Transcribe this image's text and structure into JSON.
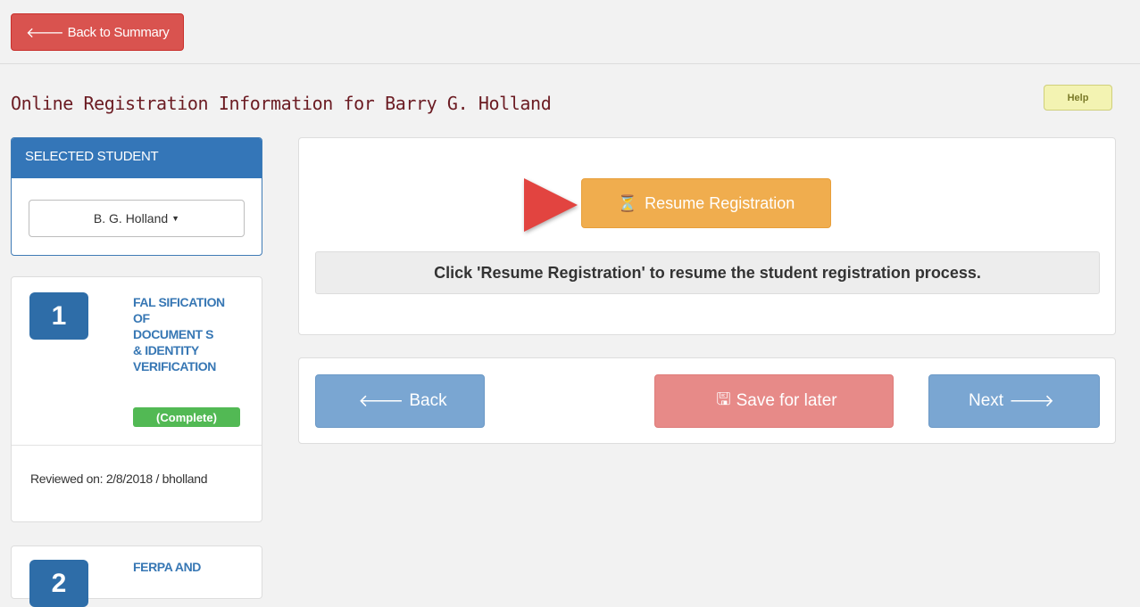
{
  "topbar": {
    "back_label": "Back to Summary"
  },
  "page": {
    "title": "Online Registration Information for Barry G. Holland",
    "help_label": "Help"
  },
  "student_panel": {
    "heading": "SELECTED STUDENT",
    "selected": "B. G. Holland"
  },
  "steps": [
    {
      "number": "1",
      "title_lines": [
        "FAL SIFICATION",
        "OF",
        "DOCUMENT S",
        "& IDENTITY",
        "VERIFICATION"
      ],
      "status": "(Complete)",
      "reviewed": "Reviewed on:  2/8/2018 / bholland"
    },
    {
      "number": "2",
      "title_lines": [
        "FERPA AND"
      ]
    }
  ],
  "main": {
    "resume_label": "Resume Registration",
    "message": "Click 'Resume Registration' to resume the student registration process."
  },
  "nav": {
    "back_label": "Back",
    "save_label": "Save for later",
    "next_label": "Next"
  },
  "icons": {
    "back_arrow": "arrow-left-icon",
    "hourglass": "hourglass-icon",
    "save": "save-icon",
    "next_arrow": "arrow-right-icon",
    "caret": "caret-down-icon"
  },
  "colors": {
    "danger": "#d9534f",
    "primary": "#3476b8",
    "warning": "#f0ad4e",
    "success": "#52b954",
    "title": "#6b1b22"
  }
}
